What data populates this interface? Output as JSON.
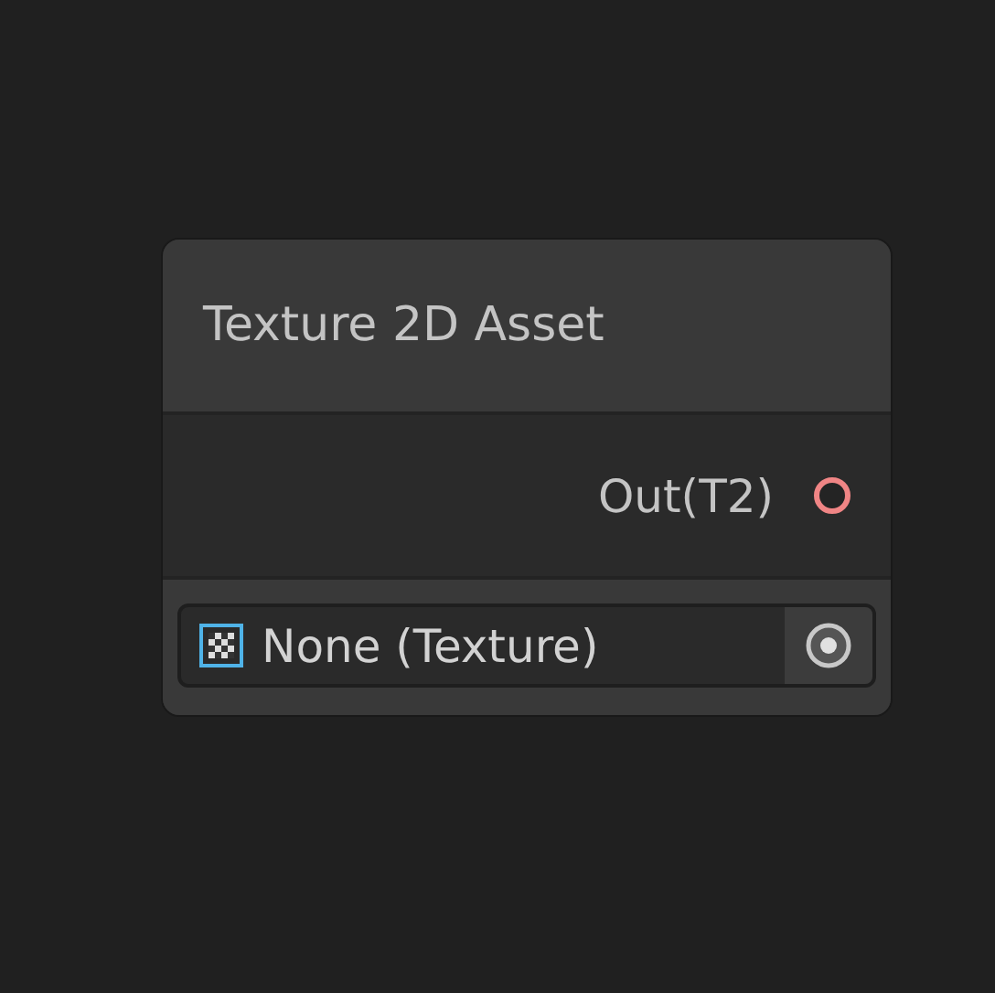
{
  "node": {
    "title": "Texture 2D Asset",
    "ports": [
      {
        "label": "Out(T2)",
        "connected": false
      }
    ],
    "field": {
      "value": "None (Texture)"
    }
  }
}
